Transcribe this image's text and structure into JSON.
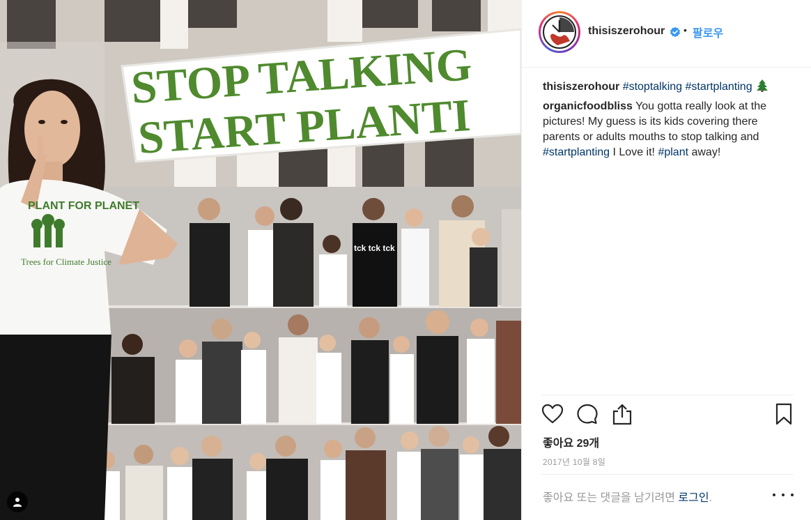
{
  "photo": {
    "banner_line1": "STOP TALKING",
    "banner_line2": "START PLANTI",
    "shirt_text_top": "PLANT FOR PLANET",
    "shirt_text_bottom": "Trees for Climate Justice",
    "shirt_small_text": "tck tck tck",
    "tag_icon": "person-tag-icon"
  },
  "post": {
    "username": "thisiszerohour",
    "verified_icon": "verified-badge-icon",
    "separator": "•",
    "follow_label": "팔로우",
    "accent_color": "#3897f0",
    "hashtag_color": "#003569"
  },
  "comments": [
    {
      "user": "thisiszerohour",
      "parts": [
        {
          "type": "tag",
          "text": "#stoptalking"
        },
        {
          "type": "text",
          "text": " "
        },
        {
          "type": "tag",
          "text": "#startplanting"
        }
      ],
      "emoji_icon": "evergreen-tree-icon"
    },
    {
      "user": "organicfoodbliss",
      "parts": [
        {
          "type": "text",
          "text": " You gotta really look at the pictures! My guess is its kids covering there parents or adults mouths to stop talking and "
        },
        {
          "type": "tag",
          "text": "#startplanting"
        },
        {
          "type": "text",
          "text": " I Love it! "
        },
        {
          "type": "tag",
          "text": "#plant"
        },
        {
          "type": "text",
          "text": " away!"
        }
      ]
    }
  ],
  "actions": {
    "like_icon": "heart-icon",
    "comment_icon": "comment-bubble-icon",
    "share_icon": "share-upload-icon",
    "save_icon": "bookmark-icon"
  },
  "likes_text": "좋아요 29개",
  "date_text": "2017년 10월 8일",
  "login_prompt": {
    "prefix": "좋아요 또는 댓글을 남기려면 ",
    "link": "로그인",
    "suffix": ".",
    "more_icon": "more-options-icon"
  }
}
